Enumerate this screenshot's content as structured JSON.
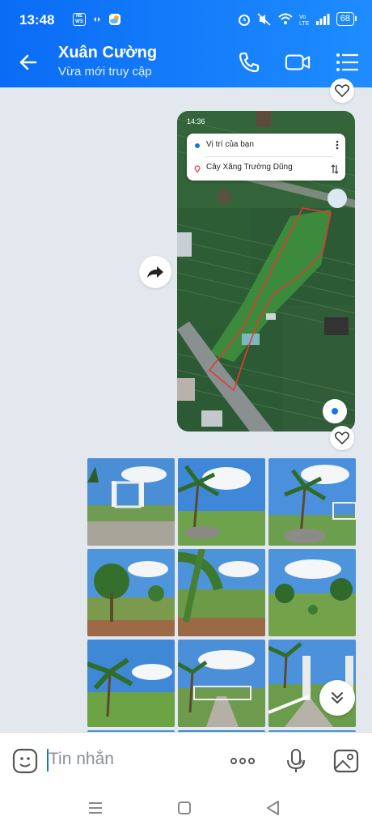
{
  "status_bar": {
    "time": "13:48",
    "battery": "68",
    "left_icons": [
      "news-icon",
      "sync-icon",
      "weather-icon"
    ],
    "right_icons": [
      "alarm-icon",
      "mute-icon",
      "wifi-icon",
      "volte-icon",
      "signal-icon",
      "battery-icon"
    ]
  },
  "header": {
    "title": "Xuân Cường",
    "subtitle": "Vừa mới truy cập",
    "actions": [
      "phone-icon",
      "video-call-icon",
      "menu-icon"
    ]
  },
  "map_message": {
    "phone_time": "14:36",
    "origin_label": "Vị trí của bạn",
    "destination_label": "Cây Xăng Trường Dũng"
  },
  "photo_album": {
    "count_visible": 12
  },
  "input": {
    "placeholder": "Tin nhắn"
  },
  "colors": {
    "header_start": "#0a6cf5",
    "header_end": "#1e8cff",
    "chat_bg": "#e3e8ef",
    "accent": "#1a73e8",
    "boundary": "#e53935"
  }
}
